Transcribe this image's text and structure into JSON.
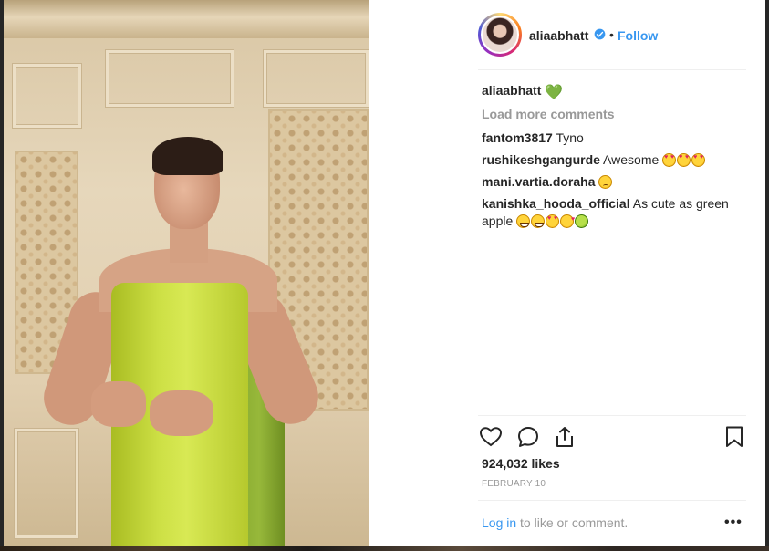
{
  "post": {
    "username": "aliaabhatt",
    "follow_label": "Follow",
    "dot": "•",
    "caption_user": "aliaabhatt",
    "caption_text": "💚",
    "load_more": "Load more comments",
    "comments": [
      {
        "user": "fantom3817",
        "text": "Tyno"
      },
      {
        "user": "rushikeshgangurde",
        "text": "Awesome"
      },
      {
        "user": "mani.vartia.doraha",
        "text": ""
      },
      {
        "user": "kanishka_hooda_official",
        "text": "As cute as green apple"
      }
    ],
    "likes": "924,032 likes",
    "date": "FEBRUARY 10",
    "login_link": "Log in",
    "login_rest": " to like or comment.",
    "more_label": "•••"
  },
  "icons": {
    "verified": "verified-badge-icon",
    "like": "heart-outline-icon",
    "comment": "speech-bubble-icon",
    "share": "share-upload-icon",
    "save": "bookmark-icon"
  },
  "colors": {
    "accent": "#3897f0",
    "muted": "#999999",
    "text": "#262626"
  }
}
